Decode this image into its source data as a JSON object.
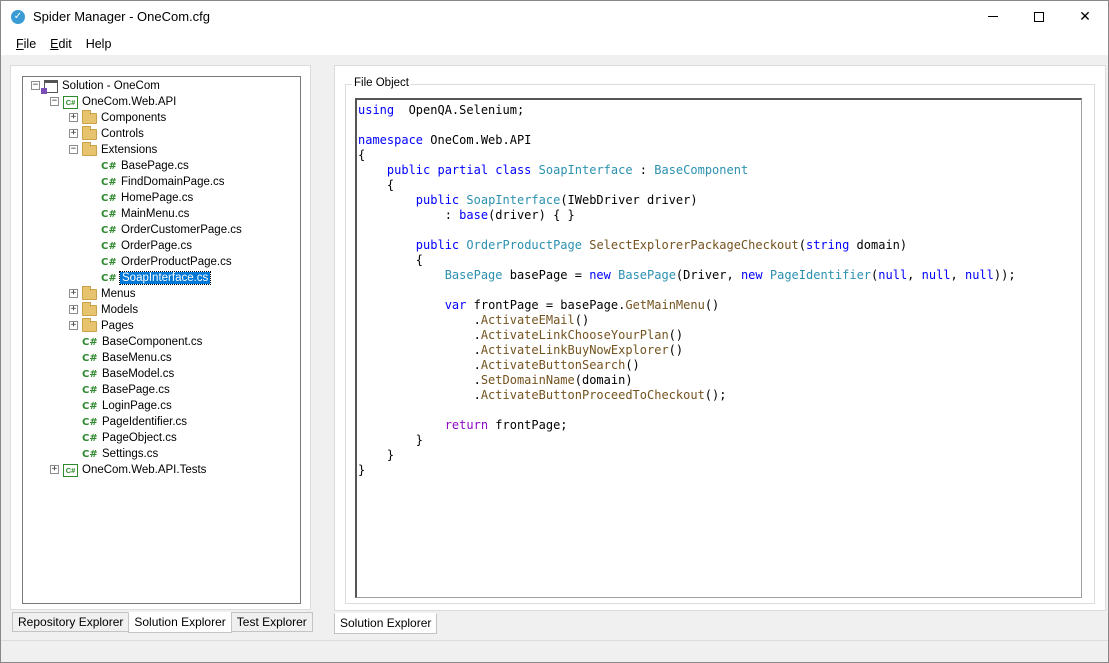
{
  "window": {
    "title": "Spider Manager - OneCom.cfg",
    "minimize": "",
    "maximize": "",
    "close": "✕"
  },
  "menu": {
    "file": {
      "key": "F",
      "rest": "ile"
    },
    "edit": {
      "key": "E",
      "rest": "dit"
    },
    "help": {
      "key": "",
      "rest": "Help"
    }
  },
  "tree": {
    "items": [
      {
        "label": "Solution - OneCom",
        "icon": "solution",
        "level": 0,
        "expander": "−"
      },
      {
        "label": "OneCom.Web.API",
        "icon": "csproj",
        "level": 1,
        "expander": "−"
      },
      {
        "label": "Components",
        "icon": "folder",
        "level": 2,
        "expander": "+"
      },
      {
        "label": "Controls",
        "icon": "folder",
        "level": 2,
        "expander": "+"
      },
      {
        "label": "Extensions",
        "icon": "folder",
        "level": 2,
        "expander": "−"
      },
      {
        "label": "BasePage.cs",
        "icon": "cs",
        "level": 3,
        "expander": ""
      },
      {
        "label": "FindDomainPage.cs",
        "icon": "cs",
        "level": 3,
        "expander": ""
      },
      {
        "label": "HomePage.cs",
        "icon": "cs",
        "level": 3,
        "expander": ""
      },
      {
        "label": "MainMenu.cs",
        "icon": "cs",
        "level": 3,
        "expander": ""
      },
      {
        "label": "OrderCustomerPage.cs",
        "icon": "cs",
        "level": 3,
        "expander": ""
      },
      {
        "label": "OrderPage.cs",
        "icon": "cs",
        "level": 3,
        "expander": ""
      },
      {
        "label": "OrderProductPage.cs",
        "icon": "cs",
        "level": 3,
        "expander": ""
      },
      {
        "label": "SoapInterface.cs",
        "icon": "cs",
        "level": 3,
        "expander": "",
        "selected": true
      },
      {
        "label": "Menus",
        "icon": "folder",
        "level": 2,
        "expander": "+"
      },
      {
        "label": "Models",
        "icon": "folder",
        "level": 2,
        "expander": "+"
      },
      {
        "label": "Pages",
        "icon": "folder",
        "level": 2,
        "expander": "+"
      },
      {
        "label": "BaseComponent.cs",
        "icon": "cs",
        "level": 2,
        "expander": ""
      },
      {
        "label": "BaseMenu.cs",
        "icon": "cs",
        "level": 2,
        "expander": ""
      },
      {
        "label": "BaseModel.cs",
        "icon": "cs",
        "level": 2,
        "expander": ""
      },
      {
        "label": "BasePage.cs",
        "icon": "cs",
        "level": 2,
        "expander": ""
      },
      {
        "label": "LoginPage.cs",
        "icon": "cs",
        "level": 2,
        "expander": ""
      },
      {
        "label": "PageIdentifier.cs",
        "icon": "cs",
        "level": 2,
        "expander": ""
      },
      {
        "label": "PageObject.cs",
        "icon": "cs",
        "level": 2,
        "expander": ""
      },
      {
        "label": "Settings.cs",
        "icon": "cs",
        "level": 2,
        "expander": ""
      },
      {
        "label": "OneCom.Web.API.Tests",
        "icon": "csproj",
        "level": 1,
        "expander": "+"
      }
    ],
    "cs_glyph": "C#"
  },
  "left_tabs": {
    "repository": "Repository Explorer",
    "solution": "Solution Explorer",
    "test": "Test Explorer"
  },
  "file_object": {
    "legend": "File Object",
    "code": [
      [
        [
          "kw",
          "using"
        ],
        [
          "",
          "  OpenQA.Selenium;"
        ]
      ],
      [],
      [
        [
          "kw",
          "namespace"
        ],
        [
          "",
          " OneCom.Web.API"
        ]
      ],
      [
        [
          "",
          "{"
        ]
      ],
      [
        [
          "",
          "    "
        ],
        [
          "kw",
          "public partial class"
        ],
        [
          "",
          " "
        ],
        [
          "ty",
          "SoapInterface"
        ],
        [
          "",
          " : "
        ],
        [
          "ty",
          "BaseComponent"
        ]
      ],
      [
        [
          "",
          "    {"
        ]
      ],
      [
        [
          "",
          "        "
        ],
        [
          "kw",
          "public"
        ],
        [
          "",
          " "
        ],
        [
          "ty",
          "SoapInterface"
        ],
        [
          "",
          "(IWebDriver driver)"
        ]
      ],
      [
        [
          "",
          "            : "
        ],
        [
          "kw",
          "base"
        ],
        [
          "",
          "(driver) { }"
        ]
      ],
      [],
      [
        [
          "",
          "        "
        ],
        [
          "kw",
          "public"
        ],
        [
          "",
          " "
        ],
        [
          "ty",
          "OrderProductPage"
        ],
        [
          "",
          " "
        ],
        [
          "mt",
          "SelectExplorerPackageCheckout"
        ],
        [
          "",
          "("
        ],
        [
          "kw",
          "string"
        ],
        [
          "",
          " domain)"
        ]
      ],
      [
        [
          "",
          "        {"
        ]
      ],
      [
        [
          "",
          "            "
        ],
        [
          "ty",
          "BasePage"
        ],
        [
          "",
          " basePage = "
        ],
        [
          "kw",
          "new"
        ],
        [
          "",
          " "
        ],
        [
          "ty",
          "BasePage"
        ],
        [
          "",
          "(Driver, "
        ],
        [
          "kw",
          "new"
        ],
        [
          "",
          " "
        ],
        [
          "ty",
          "PageIdentifier"
        ],
        [
          "",
          "("
        ],
        [
          "kw",
          "null"
        ],
        [
          "",
          ", "
        ],
        [
          "kw",
          "null"
        ],
        [
          "",
          ", "
        ],
        [
          "kw",
          "null"
        ],
        [
          "",
          "));"
        ]
      ],
      [],
      [
        [
          "",
          "            "
        ],
        [
          "kw",
          "var"
        ],
        [
          "",
          " frontPage = basePage."
        ],
        [
          "mt",
          "GetMainMenu"
        ],
        [
          "",
          "()"
        ]
      ],
      [
        [
          "",
          "                ."
        ],
        [
          "mt",
          "ActivateEMail"
        ],
        [
          "",
          "()"
        ]
      ],
      [
        [
          "",
          "                ."
        ],
        [
          "mt",
          "ActivateLinkChooseYourPlan"
        ],
        [
          "",
          "()"
        ]
      ],
      [
        [
          "",
          "                ."
        ],
        [
          "mt",
          "ActivateLinkBuyNowExplorer"
        ],
        [
          "",
          "()"
        ]
      ],
      [
        [
          "",
          "                ."
        ],
        [
          "mt",
          "ActivateButtonSearch"
        ],
        [
          "",
          "()"
        ]
      ],
      [
        [
          "",
          "                ."
        ],
        [
          "mt",
          "SetDomainName"
        ],
        [
          "",
          "(domain)"
        ]
      ],
      [
        [
          "",
          "                ."
        ],
        [
          "mt",
          "ActivateButtonProceedToCheckout"
        ],
        [
          "",
          "();"
        ]
      ],
      [],
      [
        [
          "",
          "            "
        ],
        [
          "ctl",
          "return"
        ],
        [
          "",
          " frontPage;"
        ]
      ],
      [
        [
          "",
          "        }"
        ]
      ],
      [
        [
          "",
          "    }"
        ]
      ],
      [
        [
          "",
          "}"
        ]
      ]
    ]
  },
  "right_tabs": {
    "solution": "Solution Explorer"
  }
}
